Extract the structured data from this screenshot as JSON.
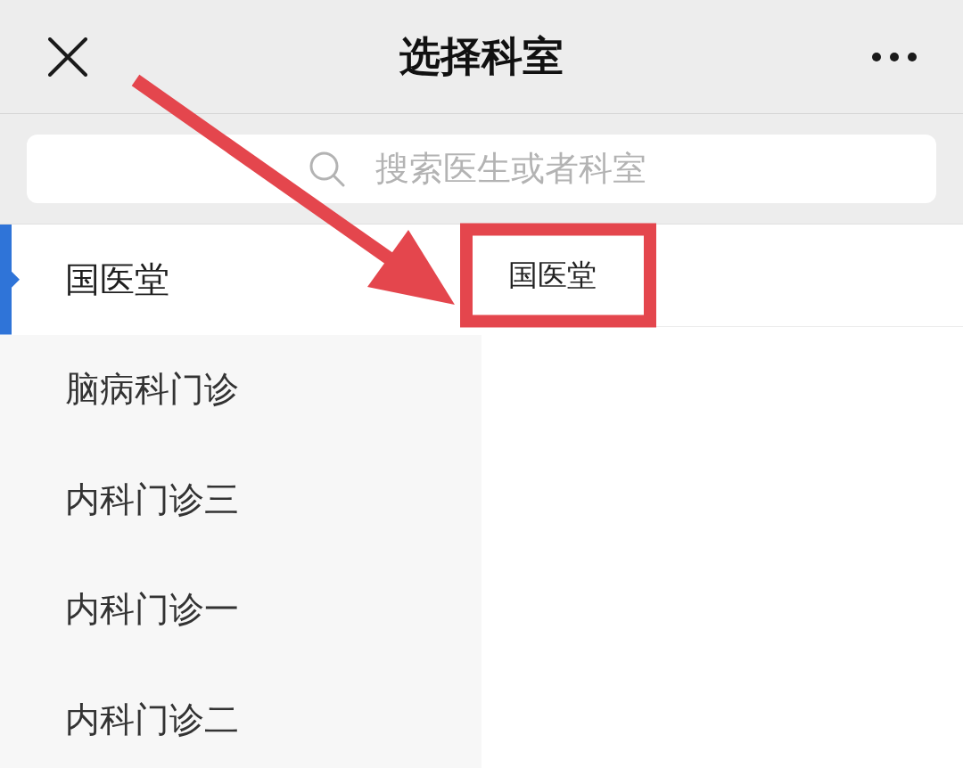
{
  "header": {
    "title": "选择科室"
  },
  "search": {
    "placeholder": "搜索医生或者科室"
  },
  "sidebar": {
    "items": [
      {
        "label": "国医堂",
        "selected": true
      },
      {
        "label": "脑病科门诊",
        "selected": false
      },
      {
        "label": "内科门诊三",
        "selected": false
      },
      {
        "label": "内科门诊一",
        "selected": false
      },
      {
        "label": "内科门诊二",
        "selected": false
      }
    ]
  },
  "departments": [
    {
      "label": "国医堂",
      "highlighted": true
    }
  ]
}
